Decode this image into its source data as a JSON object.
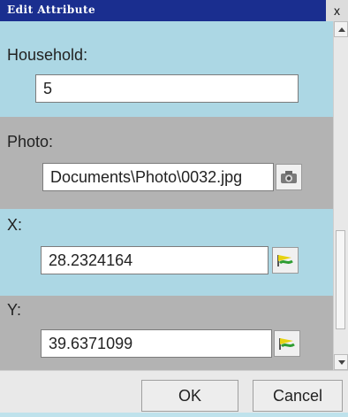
{
  "window": {
    "title": "Edit Attribute",
    "close_label": "x"
  },
  "fields": {
    "household": {
      "label": "Household:",
      "value": "5"
    },
    "photo": {
      "label": "Photo:",
      "value": "Documents\\Photo\\0032.jpg"
    },
    "x": {
      "label": "X:",
      "value": "28.2324164"
    },
    "y": {
      "label": "Y:",
      "value": "39.6371099"
    }
  },
  "buttons": {
    "ok": "OK",
    "cancel": "Cancel"
  },
  "colors": {
    "title_bar": "#1a2e8f",
    "blue_section": "#acd7e4",
    "gray_section": "#b3b3b3"
  },
  "icons": {
    "photo_button": "camera-icon",
    "gps_button": "gps-pin-icon"
  }
}
